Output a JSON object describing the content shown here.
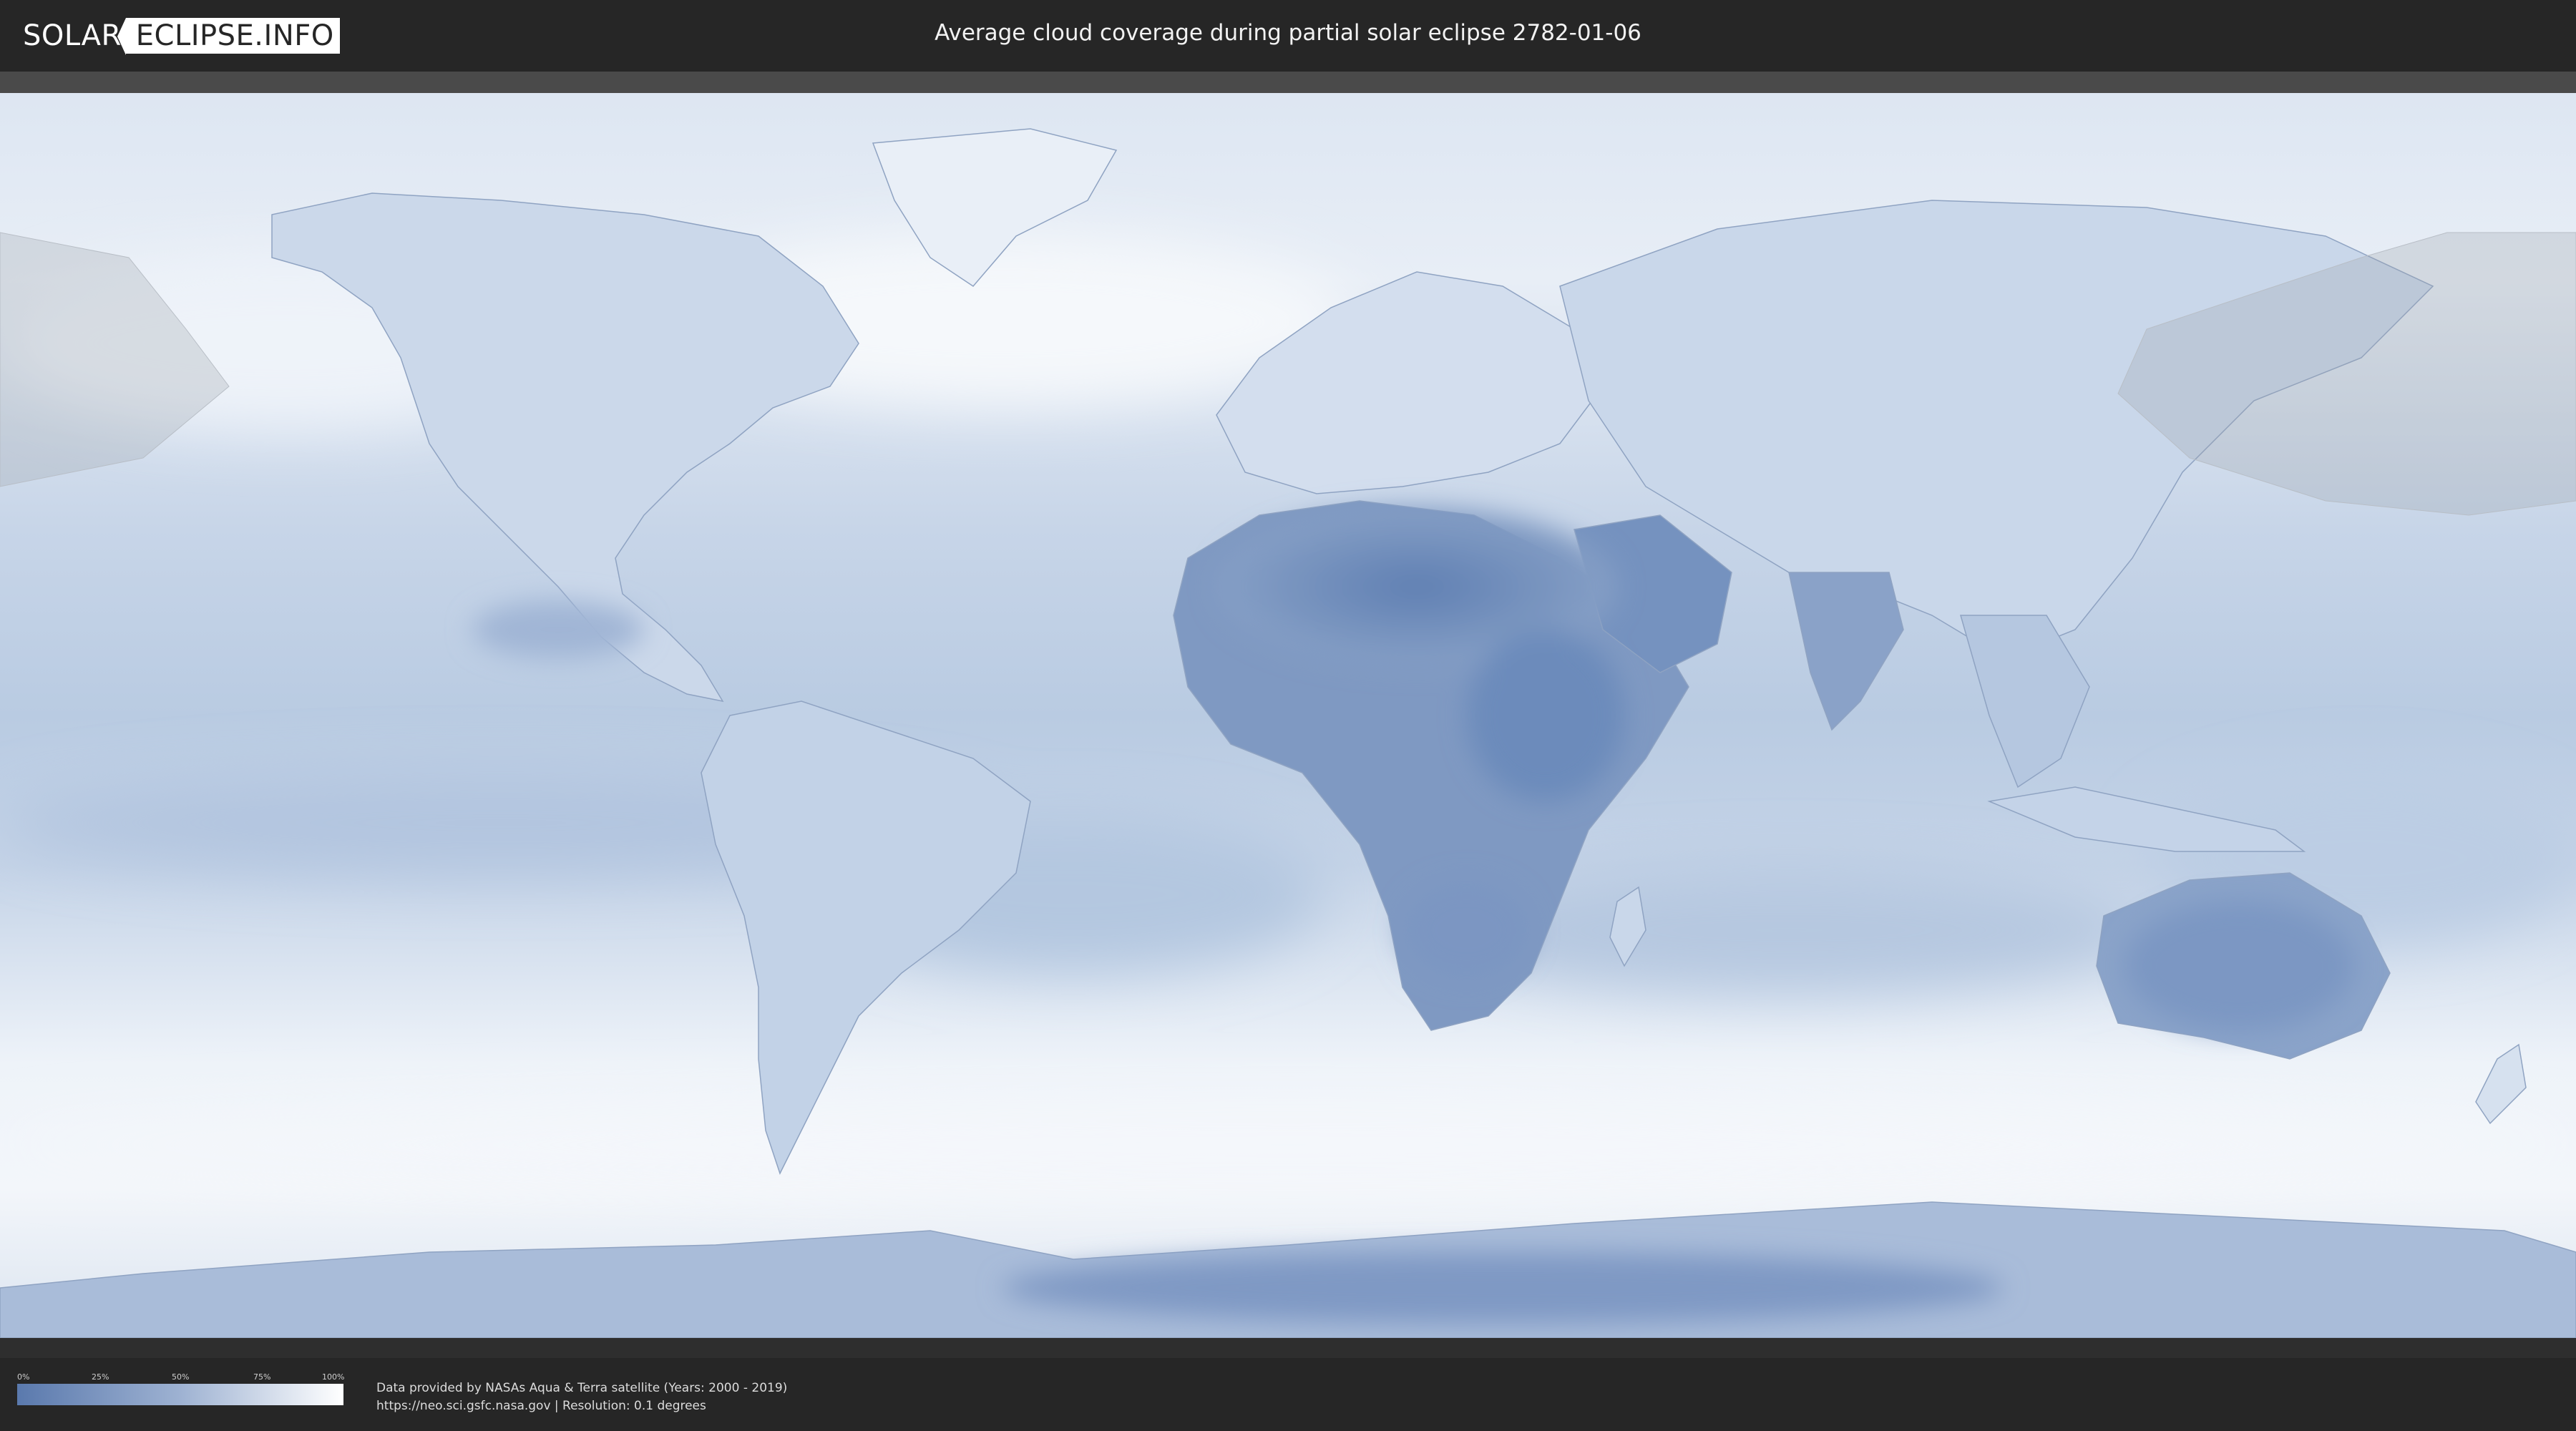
{
  "header": {
    "logo_left": "SOLAR",
    "logo_right": "ECLIPSE.INFO",
    "title": "Average cloud coverage during partial solar eclipse 2782-01-06"
  },
  "map": {
    "type": "world-cloud-coverage",
    "projection": "equirectangular",
    "eclipse_visibility_shading": [
      "north-pacific / east-asia",
      "alaska / north-pacific"
    ]
  },
  "legend": {
    "ticks": [
      "0%",
      "25%",
      "50%",
      "75%",
      "100%"
    ],
    "color_low": "#5a79ad",
    "color_mid": "#9eb2d2",
    "color_high": "#ffffff"
  },
  "footer": {
    "line1": "Data provided by NASAs Aqua & Terra satellite (Years: 2000 - 2019)",
    "line2": "https://neo.sci.gsfc.nasa.gov | Resolution: 0.1 degrees"
  },
  "colors": {
    "background": "#262626",
    "ocean_cloud": "#e6edf6",
    "dry_land": "#6f8dba"
  }
}
